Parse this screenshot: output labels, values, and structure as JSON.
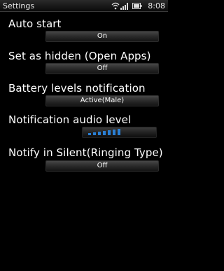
{
  "status_bar": {
    "title": "Settings",
    "time": "8:08",
    "icons": [
      "wifi-icon",
      "signal-icon",
      "battery-icon"
    ]
  },
  "settings": {
    "auto_start": {
      "label": "Auto start",
      "value": "On"
    },
    "set_hidden": {
      "label": "Set as hidden (Open Apps)",
      "value": "Off"
    },
    "battery_notification": {
      "label": "Battery levels notification",
      "value": "Active(Male)"
    },
    "audio_level": {
      "label": "Notification audio level",
      "level": 0.7
    },
    "notify_silent": {
      "label": "Notify in Silent(Ringing Type)",
      "value": "Off"
    }
  },
  "colors": {
    "accent": "#2a7fd4",
    "background": "#000000"
  }
}
